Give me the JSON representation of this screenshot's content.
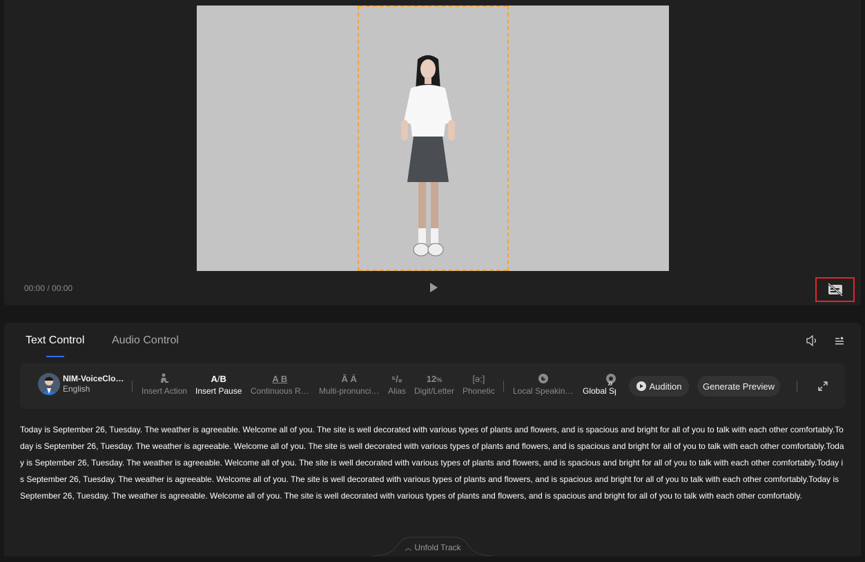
{
  "player": {
    "time": "00:00 / 00:00",
    "play_icon": "play-icon",
    "subtitle_toggle_icon": "subtitle-off-icon"
  },
  "tabs": [
    {
      "label": "Text Control",
      "active": true
    },
    {
      "label": "Audio Control",
      "active": false
    }
  ],
  "header_icons": [
    "volume-icon",
    "settings-list-icon"
  ],
  "voice": {
    "name": "NIM-VoiceClo…",
    "language": "English"
  },
  "tools": [
    {
      "icon": "insert-action-icon",
      "label": "Insert Action",
      "enabled": false
    },
    {
      "icon": "insert-pause-icon",
      "label": "Insert Pause",
      "enabled": true
    },
    {
      "icon": "continuous-reading-icon",
      "label": "Continuous R…",
      "enabled": false
    },
    {
      "icon": "multi-pronunciation-icon",
      "label": "Multi-pronunci…",
      "enabled": false
    },
    {
      "icon": "alias-icon",
      "label": "Alias",
      "enabled": false
    },
    {
      "icon": "digit-letter-icon",
      "label": "Digit/Letter",
      "enabled": false
    },
    {
      "icon": "phonetic-icon",
      "label": "Phonetic",
      "enabled": false
    },
    {
      "icon": "local-speaking-icon",
      "label": "Local Speakin…",
      "enabled": false
    },
    {
      "icon": "global-speaking-icon",
      "label": "Global Sp",
      "enabled": true
    }
  ],
  "more_icon": "chevron-double-right-icon",
  "buttons": {
    "audition": "Audition",
    "generate_preview": "Generate Preview"
  },
  "expand_icon": "expand-icon",
  "script_text": "Today is September 26, Tuesday. The weather is agreeable. Welcome all of you. The site is well decorated with various types of plants and flowers, and is spacious and bright for all of you to talk with each other comfortably.Today is September 26, Tuesday. The weather is agreeable. Welcome all of you. The site is well decorated with various types of plants and flowers, and is spacious and bright for all of you to talk with each other comfortably.Today is September 26, Tuesday. The weather is agreeable. Welcome all of you. The site is well decorated with various types of plants and flowers, and is spacious and bright for all of you to talk with each other comfortably.Today is September 26, Tuesday. The weather is agreeable. Welcome all of you. The site is well decorated with various types of plants and flowers, and is spacious and bright for all of you to talk with each other comfortably.Today is September 26, Tuesday. The weather is agreeable. Welcome all of you. The site is well decorated with various types of plants and flowers, and is spacious and bright for all of you to talk with each other comfortably.",
  "unfold_track": "Unfold Track",
  "colors": {
    "accent": "#2f6bff",
    "highlight_box": "#e0262b",
    "safe_frame": "#f0a53a"
  }
}
